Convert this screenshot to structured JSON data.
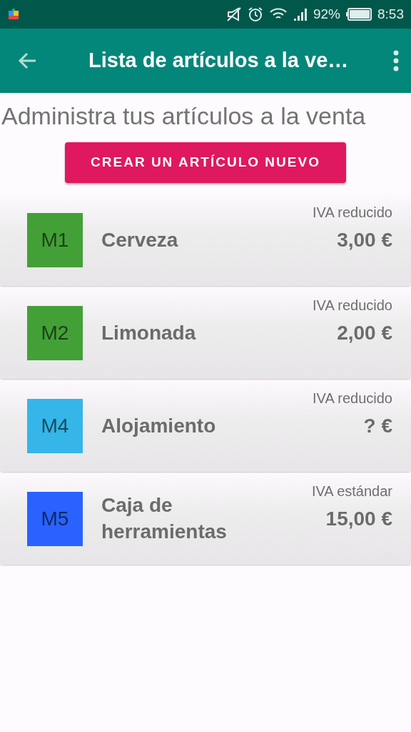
{
  "status_bar": {
    "battery": "92%",
    "time": "8:53"
  },
  "app_bar": {
    "title": "Lista de artículos a la ve…"
  },
  "heading": "Administra tus artículos a la venta",
  "create_button": "CREAR UN ARTÍCULO NUEVO",
  "items": [
    {
      "code": "M1",
      "color": "#43a037",
      "name": "Cerveza",
      "tax": "IVA reducido",
      "price": "3,00 €"
    },
    {
      "code": "M2",
      "color": "#43a037",
      "name": "Limonada",
      "tax": "IVA reducido",
      "price": "2,00 €"
    },
    {
      "code": "M4",
      "color": "#35b5e8",
      "name": "Alojamiento",
      "tax": "IVA reducido",
      "price": "? €"
    },
    {
      "code": "M5",
      "color": "#2962ff",
      "name": "Caja de herramientas",
      "tax": "IVA estándar",
      "price": "15,00 €"
    }
  ]
}
